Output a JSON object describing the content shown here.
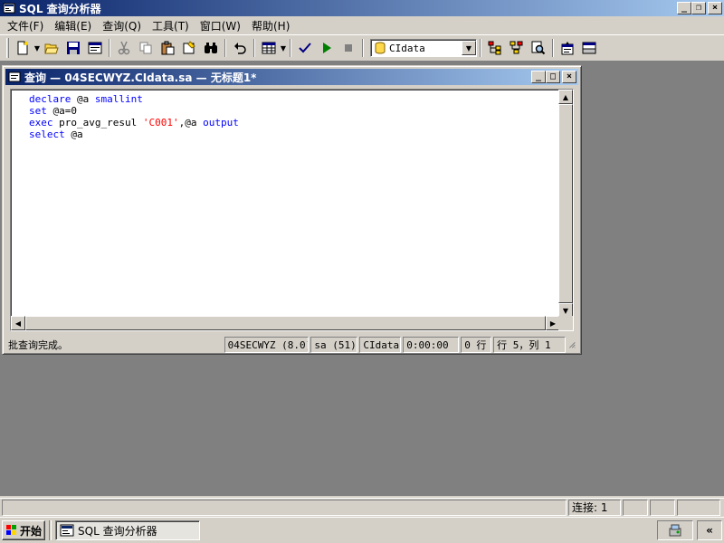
{
  "window": {
    "title": "SQL 查询分析器"
  },
  "menu": [
    {
      "label": "文件(F)"
    },
    {
      "label": "编辑(E)"
    },
    {
      "label": "查询(Q)"
    },
    {
      "label": "工具(T)"
    },
    {
      "label": "窗口(W)"
    },
    {
      "label": "帮助(H)"
    }
  ],
  "toolbar": {
    "database": "CIdata",
    "icons": [
      "new-query-icon",
      "open-icon",
      "save-icon",
      "load-template-icon",
      "cut-icon",
      "copy-icon",
      "paste-icon",
      "clear-window-icon",
      "find-icon",
      "undo-icon",
      "results-grid-icon",
      "parse-icon",
      "execute-icon",
      "stop-icon",
      "object-browser-icon",
      "object-search-icon",
      "execution-plan-icon",
      "properties-icon",
      "show-results-icon"
    ]
  },
  "child": {
    "title": "查询 — 04SECWYZ.CIdata.sa — 无标题1*",
    "code": [
      [
        {
          "t": "declare",
          "c": "kw"
        },
        {
          "t": " @a ",
          "c": ""
        },
        {
          "t": "smallint",
          "c": "kw"
        }
      ],
      [
        {
          "t": "set",
          "c": "kw"
        },
        {
          "t": " @a=0",
          "c": ""
        }
      ],
      [
        {
          "t": "exec",
          "c": "kw"
        },
        {
          "t": " pro_avg_resul ",
          "c": ""
        },
        {
          "t": "'C001'",
          "c": "str"
        },
        {
          "t": ",@a ",
          "c": ""
        },
        {
          "t": "output",
          "c": "kw"
        }
      ],
      [
        {
          "t": "select",
          "c": "kw"
        },
        {
          "t": " @a",
          "c": ""
        }
      ]
    ],
    "status": {
      "message": "批查询完成。",
      "server": "04SECWYZ (8.0)",
      "user": "sa (51)",
      "database": "CIdata",
      "time": "0:00:00",
      "rows": "0 行",
      "position": "行 5，列 1"
    }
  },
  "appstatus": {
    "connections": "连接: 1"
  },
  "taskbar": {
    "start": "开始",
    "task": "SQL 查询分析器",
    "expand": "«"
  },
  "colors": {
    "title_gradient_start": "#0a246a",
    "title_gradient_end": "#a6caf0",
    "keyword": "#0000ff",
    "string": "#ff0000",
    "mdi_bg": "#808080",
    "face": "#d4d0c8"
  }
}
